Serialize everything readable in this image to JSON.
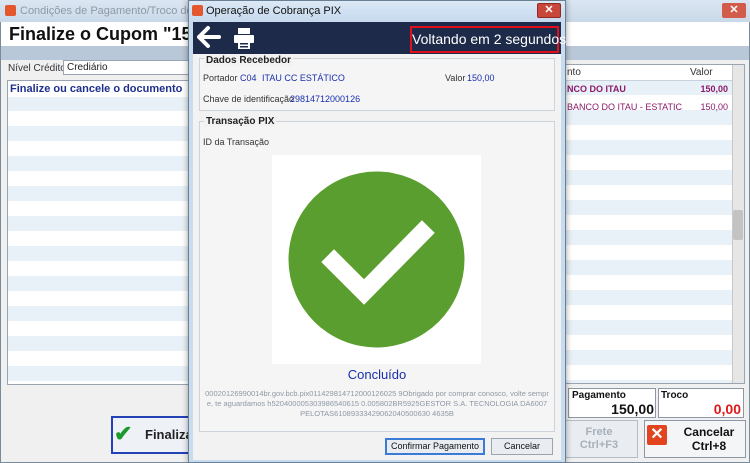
{
  "background": {
    "window_title": "Condições de Pagamento/Troco do Cupom",
    "header_title": "Finalize o Cupom \"153\"",
    "nivel_credito_label": "Nível Crédito",
    "nivel_credito_value": "Crediário",
    "left_grid_title": "Finalize ou cancele o documento",
    "finalizar_label": "Finaliza",
    "right_grid": {
      "col1": "nto",
      "col2": "Valor",
      "rows": [
        {
          "name": "NCO DO ITAU",
          "value": "150,00"
        },
        {
          "name": "BANCO DO ITAU - ESTATIC",
          "value": "150,00"
        }
      ]
    },
    "pagamento_label": "Pagamento",
    "pagamento_value": "150,00",
    "troco_label": "Troco",
    "troco_value": "0,00",
    "frete_label": "Frete\nCtrl+F3",
    "cancelar_label": "Cancelar\nCtrl+8"
  },
  "dialog": {
    "title": "Operação de Cobrança PIX",
    "countdown": "Voltando em 2 segundos",
    "dados_recebedor": {
      "title": "Dados Recebedor",
      "portador_label": "Portador",
      "portador_code": "C04",
      "portador_name": "ITAU CC ESTÁTICO",
      "valor_label": "Valor",
      "valor_value": "150,00",
      "chave_label": "Chave de identificação",
      "chave_value": "29814712000126"
    },
    "transacao": {
      "title": "Transação PIX",
      "id_label": "ID da Transação",
      "status": "Concluído",
      "pix_code": "00020126990014br.gov.bcb.pix011429814712000126025 9Obrigado por comprar conosco, volte sempre, te aguardamos h520400005303986540615 0.005802BR5925GESTOR S.A. TECNOLOGIA DA6007PELOTAS61089333429062040500630 4635B"
    },
    "confirmar_label": "Confirmar Pagamento",
    "cancelar_label": "Cancelar"
  },
  "colors": {
    "toolbar_bg": "#1e2a4a",
    "countdown_border": "#e0101a",
    "success_green": "#5a9e2f",
    "link_blue": "#1a2fae",
    "troco_red": "#e01818"
  },
  "icons": [
    "back-arrow-icon",
    "printer-icon",
    "check-circle-icon",
    "close-icon",
    "app-icon",
    "check-icon",
    "cancel-x-icon"
  ]
}
